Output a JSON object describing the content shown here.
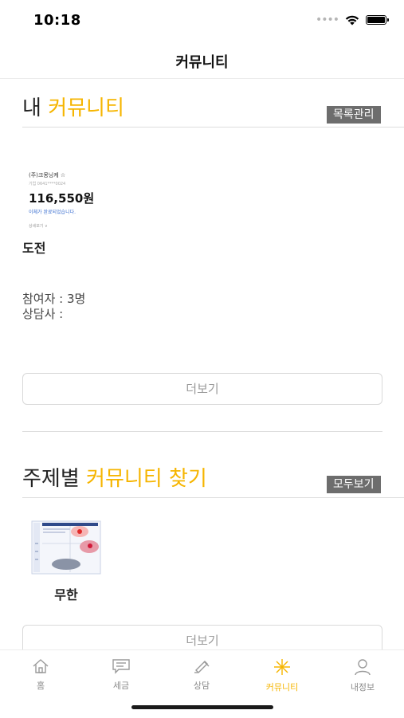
{
  "status_bar": {
    "time": "10:18",
    "signal": "••••"
  },
  "nav": {
    "title": "커뮤니티"
  },
  "my_community": {
    "title_prefix": "내",
    "title_accent": "커뮤니티",
    "manage_label": "목록관리",
    "receipt": {
      "store": "(주)크몽닝케 ☆",
      "meta": "기업 0641****0024",
      "amount": "116,550원",
      "status": "이체가 완료되었습니다.",
      "more": "상세보기 ∨"
    },
    "card_name": "도전",
    "participants": "참여자 : 3명",
    "counselor": "상담사 :",
    "more_label": "더보기"
  },
  "topic_community": {
    "title_prefix": "주제별",
    "title_accent": "커뮤니티 찾기",
    "view_all_label": "모두보기",
    "items": [
      {
        "name": "무한"
      }
    ],
    "more_label": "더보기"
  },
  "tab_bar": {
    "tabs": [
      {
        "label": "홈",
        "icon": "home-icon"
      },
      {
        "label": "세금",
        "icon": "tax-icon"
      },
      {
        "label": "상담",
        "icon": "consult-icon"
      },
      {
        "label": "커뮤니티",
        "icon": "community-icon",
        "active": true
      },
      {
        "label": "내정보",
        "icon": "profile-icon"
      }
    ]
  },
  "colors": {
    "accent": "#f6b500",
    "tag_bg": "#6d6d6d",
    "inactive": "#8a8a8a"
  }
}
